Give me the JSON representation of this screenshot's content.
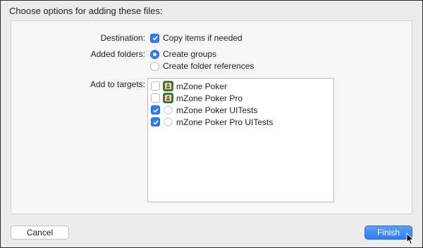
{
  "dialog": {
    "title": "Choose options for adding these files:",
    "destination": {
      "label": "Destination:",
      "option": "Copy items if needed",
      "checked": true
    },
    "added_folders": {
      "label": "Added folders:",
      "options": [
        {
          "label": "Create groups",
          "selected": true
        },
        {
          "label": "Create folder references",
          "selected": false
        }
      ]
    },
    "targets": {
      "label": "Add to targets:",
      "items": [
        {
          "label": "mZone Poker",
          "checked": false,
          "icon": "game-app-icon"
        },
        {
          "label": "mZone Poker Pro",
          "checked": false,
          "icon": "game-app-icon"
        },
        {
          "label": "mZone Poker UITests",
          "checked": true,
          "icon": "test-bundle-icon"
        },
        {
          "label": "mZone Poker Pro UITests",
          "checked": true,
          "icon": "test-bundle-icon"
        }
      ]
    },
    "buttons": {
      "cancel": "Cancel",
      "finish": "Finish"
    }
  },
  "colors": {
    "accent": "#2f7cf6",
    "background": "#ececec"
  }
}
